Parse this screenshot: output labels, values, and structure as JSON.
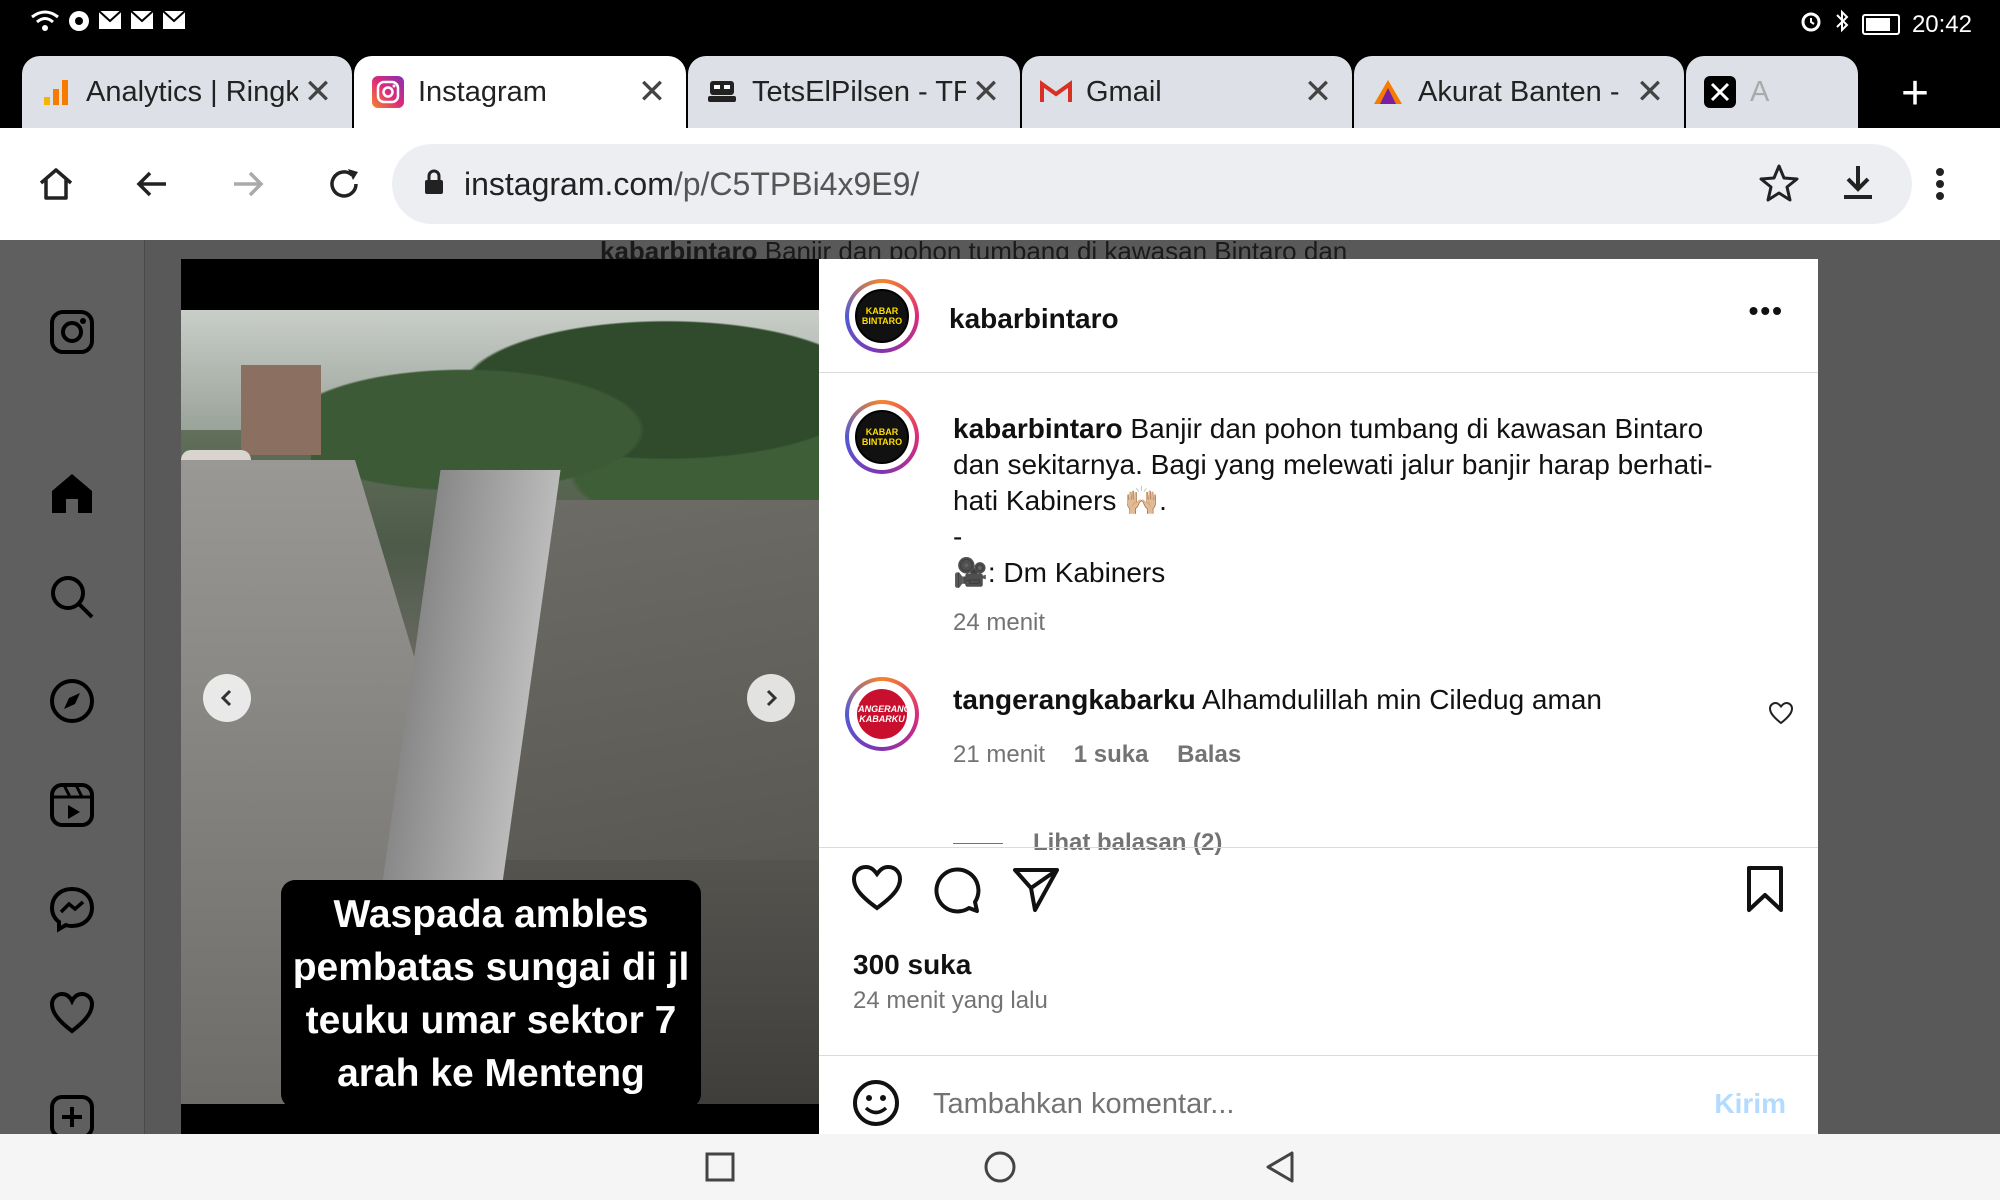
{
  "status_bar": {
    "time": "20:42"
  },
  "tabs": [
    {
      "title": "Analytics | Ringk",
      "favicon": "analytics-icon"
    },
    {
      "title": "Instagram",
      "favicon": "instagram-icon"
    },
    {
      "title": "TetsElPilsen - TF",
      "favicon": "tetselpilsen-icon"
    },
    {
      "title": "Gmail",
      "favicon": "gmail-icon"
    },
    {
      "title": "Akurat Banten -",
      "favicon": "akurat-icon"
    },
    {
      "title": "A",
      "favicon": "x-icon"
    }
  ],
  "omnibox": {
    "host": "instagram.com",
    "path": "/p/C5TPBi4x9E9/"
  },
  "background_caption": {
    "user": "kabarbintaro",
    "text": " Banjir dan pohon tumbang di kawasan Bintaro dan"
  },
  "post": {
    "author": "kabarbintaro",
    "avatar_text": "KABAR BINTARO",
    "media_overlay": "Waspada ambles pembatas sungai di jl teuku umar sektor 7 arah ke Menteng",
    "caption": {
      "user": "kabarbintaro",
      "line1": " Banjir dan pohon tumbang di kawasan Bintaro dan sekitarnya. Bagi yang melewati jalur banjir harap berhati-hati Kabiners 🙌🏼.",
      "line2": "-",
      "line3": "🎥: Dm Kabiners",
      "time": "24 menit"
    },
    "comment": {
      "user": "tangerangkabarku",
      "avatar_text": "TANGERANG KABARKU",
      "text": " Alhamdulillah min Ciledug aman",
      "time": "21 menit",
      "likes": "1 suka",
      "reply": "Balas",
      "view_replies": "Lihat balasan (2)"
    },
    "likes": "300 suka",
    "posted": "24 menit yang lalu",
    "add_comment_placeholder": "Tambahkan komentar...",
    "post_button": "Kirim"
  },
  "colors": {
    "instagram_gradient_start": "#f58529",
    "instagram_gradient_end": "#515bd4",
    "post_disabled": "#b3dbff"
  }
}
